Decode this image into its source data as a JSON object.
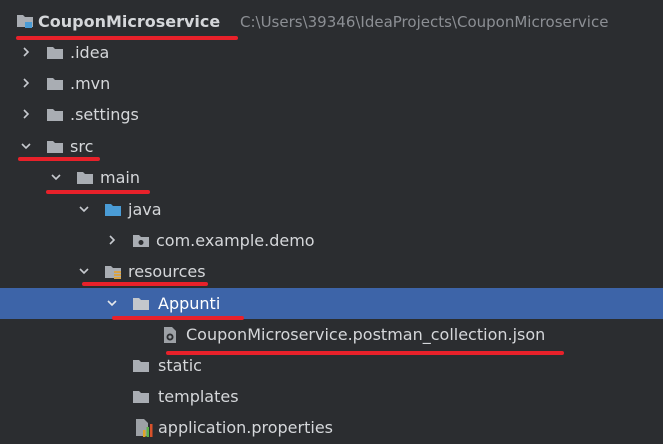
{
  "project": {
    "name": "CouponMicroservice",
    "path": "C:\\Users\\39346\\IdeaProjects\\CouponMicroservice"
  },
  "tree": {
    "idea": ".idea",
    "mvn": ".mvn",
    "settings": ".settings",
    "src": "src",
    "main": "main",
    "java": "java",
    "pkg": "com.example.demo",
    "resources": "resources",
    "appunti": "Appunti",
    "postman": "CouponMicroservice.postman_collection.json",
    "static": "static",
    "templates": "templates",
    "props": "application.properties"
  },
  "colors": {
    "background": "#2b2d30",
    "selection": "#3d64a8",
    "annotation": "#e8212a",
    "folder": "#a9adb3",
    "source_folder": "#4a9cd6"
  }
}
